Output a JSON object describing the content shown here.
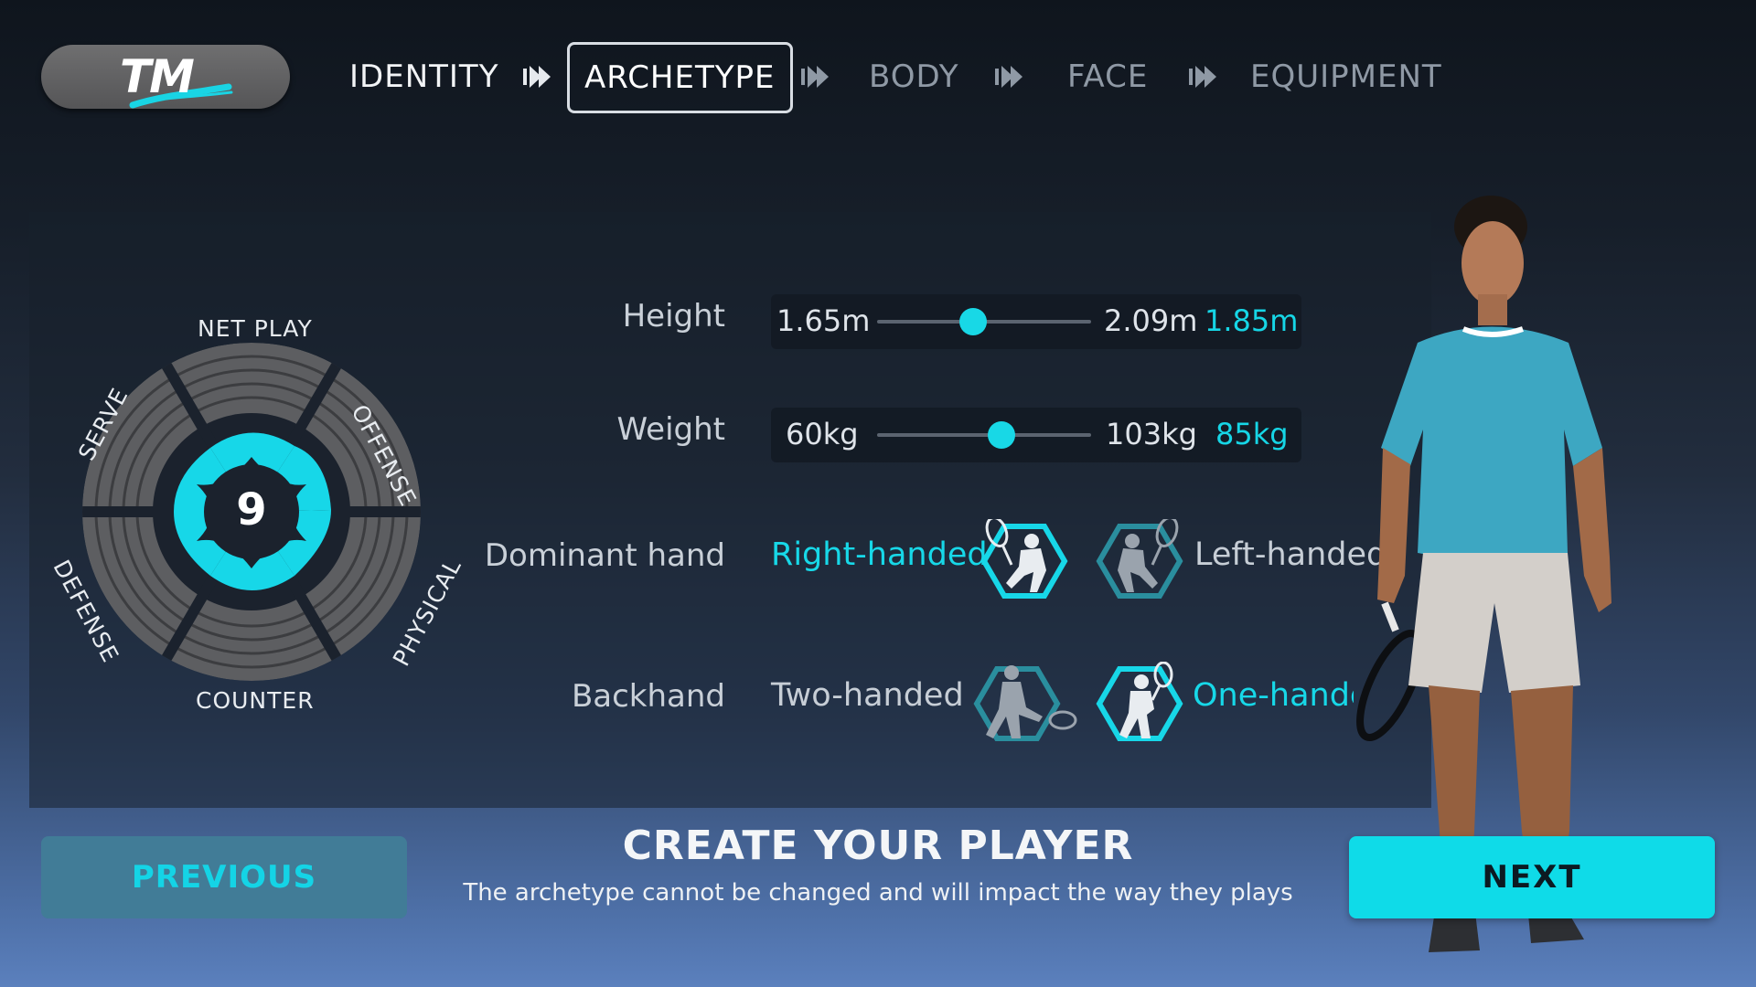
{
  "logo": {
    "text": "TM"
  },
  "steps": [
    {
      "label": "IDENTITY",
      "state": "done"
    },
    {
      "label": "ARCHETYPE",
      "state": "active"
    },
    {
      "label": "BODY",
      "state": "upcoming"
    },
    {
      "label": "FACE",
      "state": "upcoming"
    },
    {
      "label": "EQUIPMENT",
      "state": "upcoming"
    }
  ],
  "radar": {
    "score": "9",
    "labels": {
      "net_play": "NET PLAY",
      "offense": "OFFENSE",
      "physical": "PHYSICAL",
      "counter": "COUNTER",
      "defense": "DEFENSE",
      "serve": "SERVE"
    }
  },
  "attributes": {
    "height": {
      "label": "Height",
      "min": "1.65m",
      "max": "2.09m",
      "value": "1.85m",
      "fraction": 0.45
    },
    "weight": {
      "label": "Weight",
      "min": "60kg",
      "max": "103kg",
      "value": "85kg",
      "fraction": 0.58
    },
    "dominant_hand": {
      "label": "Dominant hand",
      "options": [
        "Right-handed",
        "Left-handed"
      ],
      "selected": "Right-handed"
    },
    "backhand": {
      "label": "Backhand",
      "options": [
        "Two-handed",
        "One-handed"
      ],
      "selected": "One-handed"
    }
  },
  "footer": {
    "previous": "PREVIOUS",
    "next": "NEXT",
    "title": "CREATE YOUR PLAYER",
    "subtitle": "The archetype cannot be changed and will impact the way they plays"
  },
  "colors": {
    "accent": "#16d6e6",
    "button_next": "#0fdbe8",
    "button_prev": "#417c97"
  },
  "icons": [
    "play-arrows-icon",
    "tennis-player-icon",
    "tennis-player-left-icon",
    "two-handed-backhand-icon",
    "one-handed-backhand-icon"
  ]
}
